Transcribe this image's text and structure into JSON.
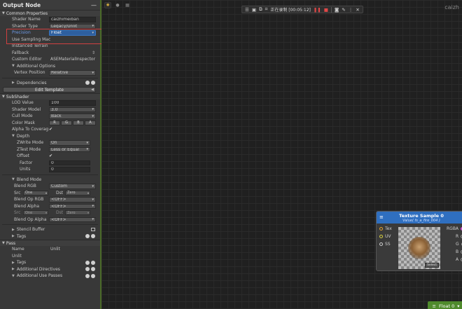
{
  "inspector": {
    "title": "Output Node",
    "common_properties": {
      "header": "Common Properties",
      "shader_name_label": "Shader Name",
      "shader_name_value": "caizhimeiban",
      "shader_type_label": "Shader Type",
      "shader_type_value": "Legacy/Unlit",
      "precision_label": "Precision",
      "precision_value": "Float",
      "use_sampling_label": "Use Sampling Mac",
      "instanced_terrain_label": "Instanced Terrain",
      "fallback_label": "Fallback",
      "custom_editor_label": "Custom Editor",
      "custom_editor_value": "ASEMaterialInspector",
      "additional_options_label": "Additional Options",
      "vertex_position_label": "Vertex Position",
      "vertex_position_value": "Relative",
      "dependencies_label": "Dependencies",
      "edit_template_label": "Edit Template"
    },
    "subshader": {
      "header": "SubShader",
      "lod_label": "LOD Value",
      "lod_value": "100",
      "shader_model_label": "Shader Model",
      "shader_model_value": "3.0",
      "cull_mode_label": "Cull Mode",
      "cull_mode_value": "Back",
      "color_mask_label": "Color Mask",
      "color_mask_channels": [
        "R",
        "G",
        "B",
        "A"
      ],
      "alpha_coverage_label": "Alpha To Coverag",
      "alpha_coverage_value": "✔",
      "depth_label": "Depth",
      "zwrite_label": "ZWrite Mode",
      "zwrite_value": "On",
      "ztest_label": "ZTest Mode",
      "ztest_value": "Less or Equal",
      "offset_label": "Offset",
      "offset_value": "✔",
      "factor_label": "Factor",
      "factor_value": "0",
      "units_label": "Units",
      "units_value": "0",
      "blend_mode_label": "Blend Mode",
      "blend_rgb_label": "Blend RGB",
      "blend_rgb_value": "Custom",
      "src_label": "Src",
      "src_value": "One",
      "dst_label": "Dst",
      "dst_value": "Zero",
      "blend_op_rgb_label": "Blend Op RGB",
      "blend_op_rgb_value": "<OFF>",
      "blend_alpha_label": "Blend Alpha",
      "blend_alpha_value": "<OFF>",
      "src2_label": "Src",
      "src2_value": "One",
      "dst2_label": "Dst",
      "dst2_value": "Zero",
      "blend_op_alpha_label": "Blend Op Alpha",
      "blend_op_alpha_value": "<OFF>",
      "stencil_label": "Stencil Buffer",
      "tags_label": "Tags"
    },
    "pass": {
      "header": "Pass",
      "name_label": "Name",
      "name_value": "Unlit",
      "unlit_label": "Unlit",
      "tags_label": "Tags",
      "additional_directives_label": "Additional Directives",
      "additional_use_passes_label": "Additional Use Passes"
    }
  },
  "canvas": {
    "recording_label": "正在录制 [00:05:12]",
    "shader_name": "caizh",
    "texture_node": {
      "title": "Texture Sample 0",
      "subtitle": "Value( fs_a_fire_004 )",
      "inputs": [
        "Tex",
        "UV",
        "SS"
      ],
      "outputs": [
        "RGBA",
        "R",
        "G",
        "B",
        "A"
      ],
      "select_label": "Select"
    },
    "float_node": {
      "title": "Float 0"
    }
  },
  "colors": {
    "accent_blue": "#2f6fc0",
    "highlight_outline": "#d04040",
    "float_green": "#4f8a2c",
    "rec_red": "#e04848"
  }
}
